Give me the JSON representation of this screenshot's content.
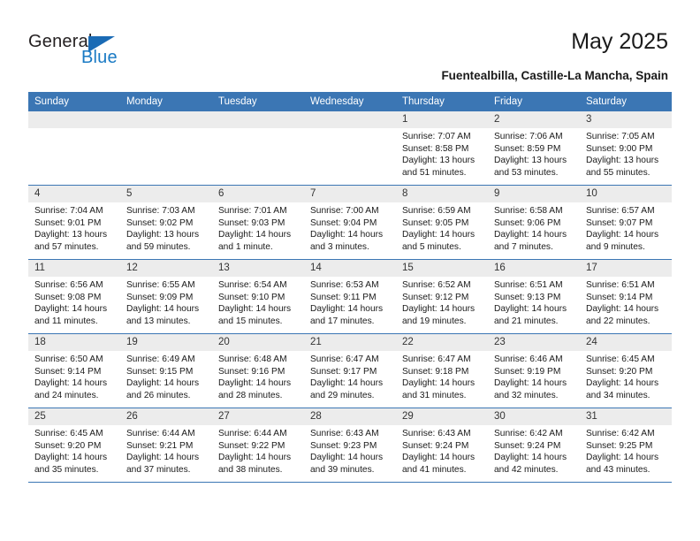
{
  "brand": {
    "name_top": "General",
    "name_bottom": "Blue",
    "triangle_color": "#1a6bb5",
    "blue_color": "#1a7ac4"
  },
  "header": {
    "title": "May 2025",
    "subtitle": "Fuentealbilla, Castille-La Mancha, Spain",
    "accent_color": "#3b76b4",
    "daynum_bg": "#ececec"
  },
  "calendar": {
    "weekday_headers": [
      "Sunday",
      "Monday",
      "Tuesday",
      "Wednesday",
      "Thursday",
      "Friday",
      "Saturday"
    ],
    "labels": {
      "sunrise": "Sunrise:",
      "sunset": "Sunset:",
      "daylight": "Daylight:"
    },
    "weeks": [
      [
        {
          "day": "",
          "empty": true
        },
        {
          "day": "",
          "empty": true
        },
        {
          "day": "",
          "empty": true
        },
        {
          "day": "",
          "empty": true
        },
        {
          "day": "1",
          "sunrise": "Sunrise: 7:07 AM",
          "sunset": "Sunset: 8:58 PM",
          "daylight": "Daylight: 13 hours and 51 minutes."
        },
        {
          "day": "2",
          "sunrise": "Sunrise: 7:06 AM",
          "sunset": "Sunset: 8:59 PM",
          "daylight": "Daylight: 13 hours and 53 minutes."
        },
        {
          "day": "3",
          "sunrise": "Sunrise: 7:05 AM",
          "sunset": "Sunset: 9:00 PM",
          "daylight": "Daylight: 13 hours and 55 minutes."
        }
      ],
      [
        {
          "day": "4",
          "sunrise": "Sunrise: 7:04 AM",
          "sunset": "Sunset: 9:01 PM",
          "daylight": "Daylight: 13 hours and 57 minutes."
        },
        {
          "day": "5",
          "sunrise": "Sunrise: 7:03 AM",
          "sunset": "Sunset: 9:02 PM",
          "daylight": "Daylight: 13 hours and 59 minutes."
        },
        {
          "day": "6",
          "sunrise": "Sunrise: 7:01 AM",
          "sunset": "Sunset: 9:03 PM",
          "daylight": "Daylight: 14 hours and 1 minute."
        },
        {
          "day": "7",
          "sunrise": "Sunrise: 7:00 AM",
          "sunset": "Sunset: 9:04 PM",
          "daylight": "Daylight: 14 hours and 3 minutes."
        },
        {
          "day": "8",
          "sunrise": "Sunrise: 6:59 AM",
          "sunset": "Sunset: 9:05 PM",
          "daylight": "Daylight: 14 hours and 5 minutes."
        },
        {
          "day": "9",
          "sunrise": "Sunrise: 6:58 AM",
          "sunset": "Sunset: 9:06 PM",
          "daylight": "Daylight: 14 hours and 7 minutes."
        },
        {
          "day": "10",
          "sunrise": "Sunrise: 6:57 AM",
          "sunset": "Sunset: 9:07 PM",
          "daylight": "Daylight: 14 hours and 9 minutes."
        }
      ],
      [
        {
          "day": "11",
          "sunrise": "Sunrise: 6:56 AM",
          "sunset": "Sunset: 9:08 PM",
          "daylight": "Daylight: 14 hours and 11 minutes."
        },
        {
          "day": "12",
          "sunrise": "Sunrise: 6:55 AM",
          "sunset": "Sunset: 9:09 PM",
          "daylight": "Daylight: 14 hours and 13 minutes."
        },
        {
          "day": "13",
          "sunrise": "Sunrise: 6:54 AM",
          "sunset": "Sunset: 9:10 PM",
          "daylight": "Daylight: 14 hours and 15 minutes."
        },
        {
          "day": "14",
          "sunrise": "Sunrise: 6:53 AM",
          "sunset": "Sunset: 9:11 PM",
          "daylight": "Daylight: 14 hours and 17 minutes."
        },
        {
          "day": "15",
          "sunrise": "Sunrise: 6:52 AM",
          "sunset": "Sunset: 9:12 PM",
          "daylight": "Daylight: 14 hours and 19 minutes."
        },
        {
          "day": "16",
          "sunrise": "Sunrise: 6:51 AM",
          "sunset": "Sunset: 9:13 PM",
          "daylight": "Daylight: 14 hours and 21 minutes."
        },
        {
          "day": "17",
          "sunrise": "Sunrise: 6:51 AM",
          "sunset": "Sunset: 9:14 PM",
          "daylight": "Daylight: 14 hours and 22 minutes."
        }
      ],
      [
        {
          "day": "18",
          "sunrise": "Sunrise: 6:50 AM",
          "sunset": "Sunset: 9:14 PM",
          "daylight": "Daylight: 14 hours and 24 minutes."
        },
        {
          "day": "19",
          "sunrise": "Sunrise: 6:49 AM",
          "sunset": "Sunset: 9:15 PM",
          "daylight": "Daylight: 14 hours and 26 minutes."
        },
        {
          "day": "20",
          "sunrise": "Sunrise: 6:48 AM",
          "sunset": "Sunset: 9:16 PM",
          "daylight": "Daylight: 14 hours and 28 minutes."
        },
        {
          "day": "21",
          "sunrise": "Sunrise: 6:47 AM",
          "sunset": "Sunset: 9:17 PM",
          "daylight": "Daylight: 14 hours and 29 minutes."
        },
        {
          "day": "22",
          "sunrise": "Sunrise: 6:47 AM",
          "sunset": "Sunset: 9:18 PM",
          "daylight": "Daylight: 14 hours and 31 minutes."
        },
        {
          "day": "23",
          "sunrise": "Sunrise: 6:46 AM",
          "sunset": "Sunset: 9:19 PM",
          "daylight": "Daylight: 14 hours and 32 minutes."
        },
        {
          "day": "24",
          "sunrise": "Sunrise: 6:45 AM",
          "sunset": "Sunset: 9:20 PM",
          "daylight": "Daylight: 14 hours and 34 minutes."
        }
      ],
      [
        {
          "day": "25",
          "sunrise": "Sunrise: 6:45 AM",
          "sunset": "Sunset: 9:20 PM",
          "daylight": "Daylight: 14 hours and 35 minutes."
        },
        {
          "day": "26",
          "sunrise": "Sunrise: 6:44 AM",
          "sunset": "Sunset: 9:21 PM",
          "daylight": "Daylight: 14 hours and 37 minutes."
        },
        {
          "day": "27",
          "sunrise": "Sunrise: 6:44 AM",
          "sunset": "Sunset: 9:22 PM",
          "daylight": "Daylight: 14 hours and 38 minutes."
        },
        {
          "day": "28",
          "sunrise": "Sunrise: 6:43 AM",
          "sunset": "Sunset: 9:23 PM",
          "daylight": "Daylight: 14 hours and 39 minutes."
        },
        {
          "day": "29",
          "sunrise": "Sunrise: 6:43 AM",
          "sunset": "Sunset: 9:24 PM",
          "daylight": "Daylight: 14 hours and 41 minutes."
        },
        {
          "day": "30",
          "sunrise": "Sunrise: 6:42 AM",
          "sunset": "Sunset: 9:24 PM",
          "daylight": "Daylight: 14 hours and 42 minutes."
        },
        {
          "day": "31",
          "sunrise": "Sunrise: 6:42 AM",
          "sunset": "Sunset: 9:25 PM",
          "daylight": "Daylight: 14 hours and 43 minutes."
        }
      ]
    ]
  }
}
